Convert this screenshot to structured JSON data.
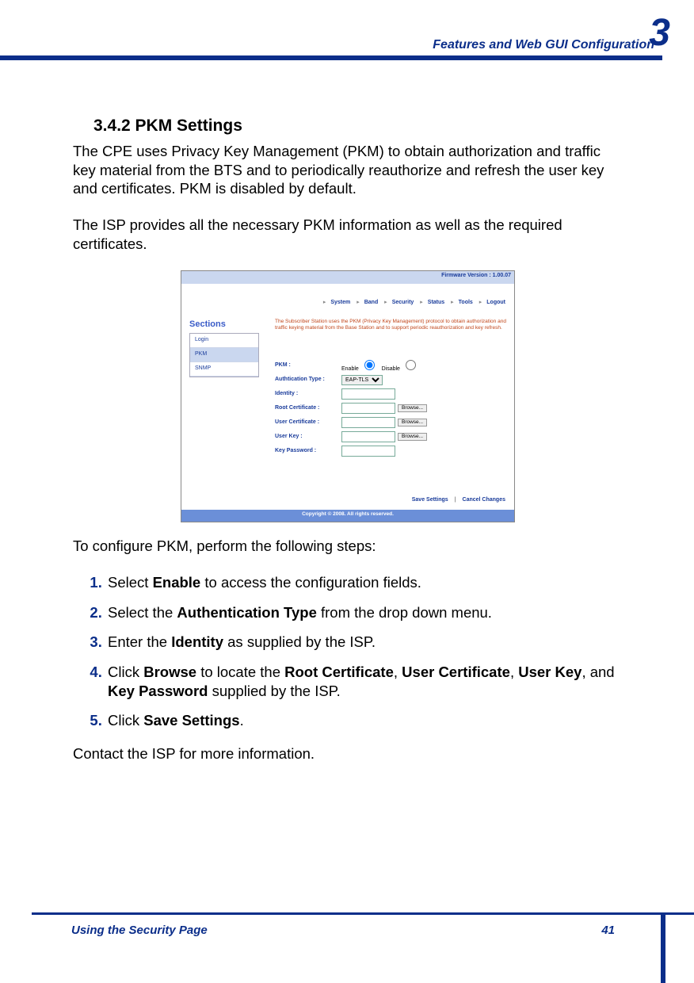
{
  "page": {
    "chapter_number": "3",
    "header_title": "Features and Web GUI Configuration",
    "footer_left": "Using the Security Page",
    "footer_right": "41"
  },
  "section": {
    "heading": "3.4.2 PKM Settings",
    "para1": "The CPE uses Privacy Key Management (PKM) to obtain authorization and traffic key material from the BTS and to periodically reauthorize and refresh the user key and certificates. PKM is disabled by default.",
    "para2": "The ISP provides all the necessary PKM information as well as the required certificates.",
    "after_image": "To configure PKM, perform the following steps:",
    "closing": "Contact the ISP for more information."
  },
  "steps": {
    "s1a": "Select ",
    "s1b": "Enable",
    "s1c": " to access the configuration fields.",
    "s2a": "Select the ",
    "s2b": "Authentication Type",
    "s2c": " from the drop down menu.",
    "s3a": "Enter the ",
    "s3b": "Identity",
    "s3c": " as supplied by the ISP.",
    "s4a": "Click ",
    "s4b": "Browse",
    "s4c": " to locate the ",
    "s4d": "Root Certificate",
    "s4e": ", ",
    "s4f": "User Certificate",
    "s4g": ", ",
    "s4h": "User Key",
    "s4i": ", and ",
    "s4j": "Key Password",
    "s4k": " supplied by the ISP.",
    "s5a": "Click ",
    "s5b": "Save Settings",
    "s5c": "."
  },
  "gui": {
    "firmware": "Firmware Version : 1.00.07",
    "nav": {
      "n1": "System",
      "n2": "Band",
      "n3": "Security",
      "n4": "Status",
      "n5": "Tools",
      "n6": "Logout"
    },
    "sections_label": "Sections",
    "sidebar": {
      "i1": "Login",
      "i2": "PKM",
      "i3": "SNMP"
    },
    "description": "The Subscriber Station uses the PKM (Privacy Key Management) protocol to obtain authorization and traffic keying material from the Base Station and to support periodic reauthorization and key refresh.",
    "fields": {
      "pkm": "PKM :",
      "enable": "Enable",
      "disable": "Disable",
      "auth": "Authtication Type :",
      "auth_value": "EAP-TLS",
      "identity": "Identity :",
      "root": "Root Certificate :",
      "user_cert": "User Certificate :",
      "user_key": "User Key :",
      "key_pw": "Key Password :",
      "browse": "Browse..."
    },
    "buttons": {
      "save": "Save Settings",
      "cancel": "Cancel Changes"
    },
    "copyright": "Copyright © 2008.  All rights reserved."
  }
}
